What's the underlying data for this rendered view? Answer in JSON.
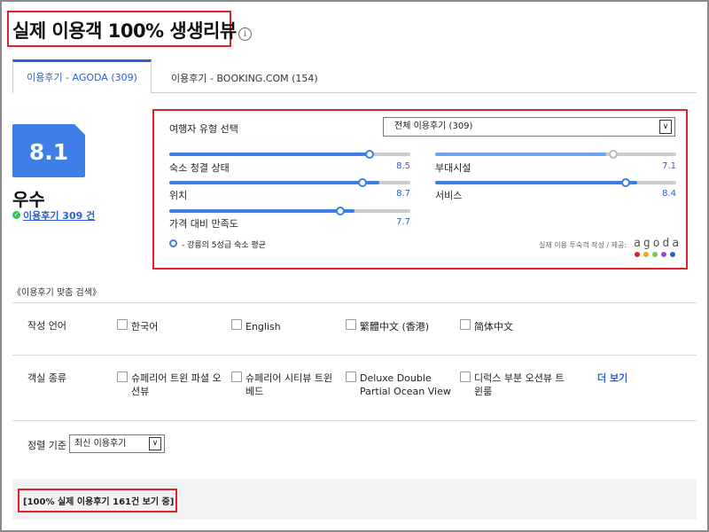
{
  "header": {
    "title": "실제 이용객 100% 생생리뷰",
    "info_icon": "i"
  },
  "tabs": [
    {
      "label": "이용후기 - AGODA (309)",
      "active": true
    },
    {
      "label": "이용후기 - BOOKING.COM (154)",
      "active": false
    }
  ],
  "summary": {
    "score": "8.1",
    "rating_label": "우수",
    "review_count": "이용후기 309 건",
    "check_icon": "✓"
  },
  "traveler_filter": {
    "label": "여행자 유형 선택",
    "selected": "전체 이용후기 (309)",
    "arrow": "∨"
  },
  "metrics": [
    {
      "label": "숙소 청결 상태",
      "value": "8.5",
      "fill": 0.85,
      "avg": 0.83
    },
    {
      "label": "부대시설",
      "value": "7.1",
      "fill": 0.71,
      "avg": 0.74
    },
    {
      "label": "위치",
      "value": "8.7",
      "fill": 0.87,
      "avg": 0.8
    },
    {
      "label": "서비스",
      "value": "8.4",
      "fill": 0.84,
      "avg": 0.79
    },
    {
      "label": "가격 대비 만족도",
      "value": "7.7",
      "fill": 0.77,
      "avg": 0.71
    }
  ],
  "legend": {
    "text": "- 강릉의 5성급 숙소 평균",
    "provider_credit": "실제 이용 투숙객 작성 / 제공:",
    "logo": "agoda",
    "logo_dot_colors": [
      "#e0222a",
      "#f5a623",
      "#7ac943",
      "#9b4dca",
      "#2a5fd6"
    ]
  },
  "search": {
    "title": "《이용후기 맞춤 검색》",
    "language_label": "작성 언어",
    "languages": [
      "한국어",
      "English",
      "繁體中文 (香港)",
      "简体中文"
    ],
    "room_label": "객실 종류",
    "rooms": [
      "슈페리어 트윈 파셜 오션뷰",
      "슈페리어 시티뷰 트윈 베드",
      "Deluxe Double Partial Ocean View",
      "디럭스 부분 오션뷰 트윈룸"
    ],
    "more": "더 보기",
    "sort_label": "정렬 기준",
    "sort_selected": "최신 이용후기",
    "sort_arrow": "∨"
  },
  "status": {
    "text": "[100% 실제 이용후기 161건 보기 중]"
  }
}
